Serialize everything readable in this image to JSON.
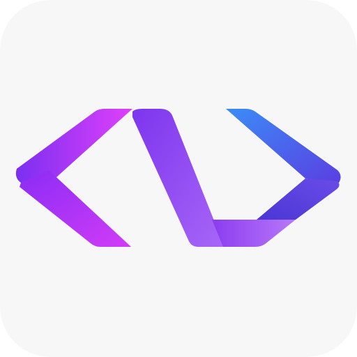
{
  "app_icon": {
    "glyph": "code-brackets-icon",
    "colors": {
      "background": "#f8f7f8",
      "magenta": "#d946ef",
      "violet": "#7c3aed",
      "purple": "#a855f7",
      "indigo": "#4f46e5",
      "blue": "#3b82f6"
    }
  }
}
